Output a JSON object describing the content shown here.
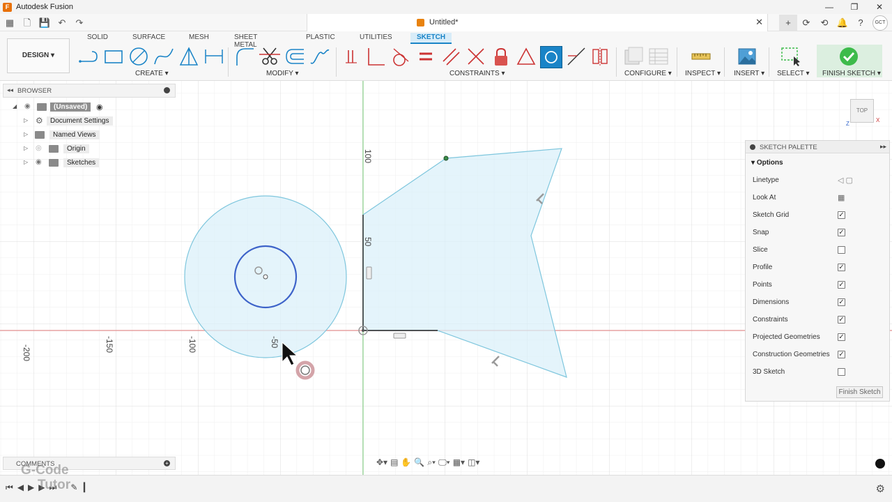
{
  "app": {
    "title": "Autodesk Fusion",
    "logo_letter": "F",
    "win_minimize": "—",
    "win_restore": "❐",
    "win_close": "✕"
  },
  "document": {
    "tab_title": "Untitled*",
    "close": "✕"
  },
  "quick_access": {
    "grid_icon": "▦",
    "file_icon": "🗋",
    "save_icon": "💾",
    "undo_icon": "↶",
    "redo_icon": "↷"
  },
  "header_right": {
    "add_icon": "+",
    "extensions_icon": "⟳",
    "job_status_icon": "⟲",
    "notifications_icon": "🔔",
    "help_icon": "?",
    "avatar_text": "GCT"
  },
  "ribbon": {
    "workspace": "DESIGN ▾",
    "tabs": [
      "SOLID",
      "SURFACE",
      "MESH",
      "SHEET METAL",
      "PLASTIC",
      "UTILITIES",
      "SKETCH"
    ],
    "active_tab": "SKETCH",
    "groups": {
      "create": "CREATE ▾",
      "modify": "MODIFY ▾",
      "constraints": "CONSTRAINTS ▾",
      "configure": "CONFIGURE ▾",
      "inspect": "INSPECT ▾",
      "insert": "INSERT ▾",
      "select": "SELECT ▾",
      "finish_sketch": "FINISH SKETCH ▾"
    },
    "accent": "#1a84c7",
    "finish_color": "#3dbb4b"
  },
  "browser": {
    "title": "BROWSER",
    "items": [
      {
        "label": "(Unsaved)"
      },
      {
        "label": "Document Settings"
      },
      {
        "label": "Named Views"
      },
      {
        "label": "Origin"
      },
      {
        "label": "Sketches"
      }
    ]
  },
  "canvas": {
    "ruler_x": [
      "-200",
      "-150",
      "-100",
      "-50"
    ],
    "ruler_y": [
      "100",
      "50"
    ],
    "viewcube_label": "TOP",
    "axis_x": "X",
    "axis_z": "Z"
  },
  "palette": {
    "title": "SKETCH PALETTE",
    "section": "Options",
    "rows": [
      {
        "label": "Linetype",
        "kind": "icon"
      },
      {
        "label": "Look At",
        "kind": "icon"
      },
      {
        "label": "Sketch Grid",
        "checked": true
      },
      {
        "label": "Snap",
        "checked": true
      },
      {
        "label": "Slice",
        "checked": false
      },
      {
        "label": "Profile",
        "checked": true
      },
      {
        "label": "Points",
        "checked": true
      },
      {
        "label": "Dimensions",
        "checked": true
      },
      {
        "label": "Constraints",
        "checked": true
      },
      {
        "label": "Projected Geometries",
        "checked": true
      },
      {
        "label": "Construction Geometries",
        "checked": true
      },
      {
        "label": "3D Sketch",
        "checked": false
      }
    ],
    "finish_button": "Finish Sketch"
  },
  "comments": {
    "title": "COMMENTS",
    "add": "+"
  },
  "watermark": {
    "line1": "G-Code",
    "line2": "Tutor"
  }
}
